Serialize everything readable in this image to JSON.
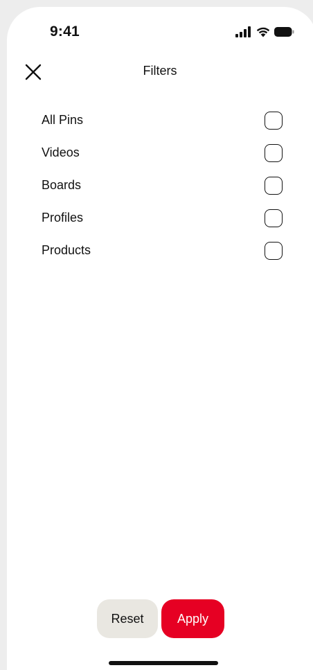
{
  "status_bar": {
    "time": "9:41",
    "icons": [
      "cellular-signal-icon",
      "wifi-icon",
      "battery-icon"
    ]
  },
  "header": {
    "title": "Filters",
    "close_icon": "close-icon"
  },
  "filters": [
    {
      "label": "All Pins",
      "checked": false
    },
    {
      "label": "Videos",
      "checked": false
    },
    {
      "label": "Boards",
      "checked": false
    },
    {
      "label": "Profiles",
      "checked": false
    },
    {
      "label": "Products",
      "checked": false
    }
  ],
  "footer": {
    "reset_label": "Reset",
    "apply_label": "Apply"
  },
  "colors": {
    "accent": "#e60023",
    "reset_bg": "#e9e7e1",
    "text": "#111111",
    "background": "#ffffff"
  }
}
